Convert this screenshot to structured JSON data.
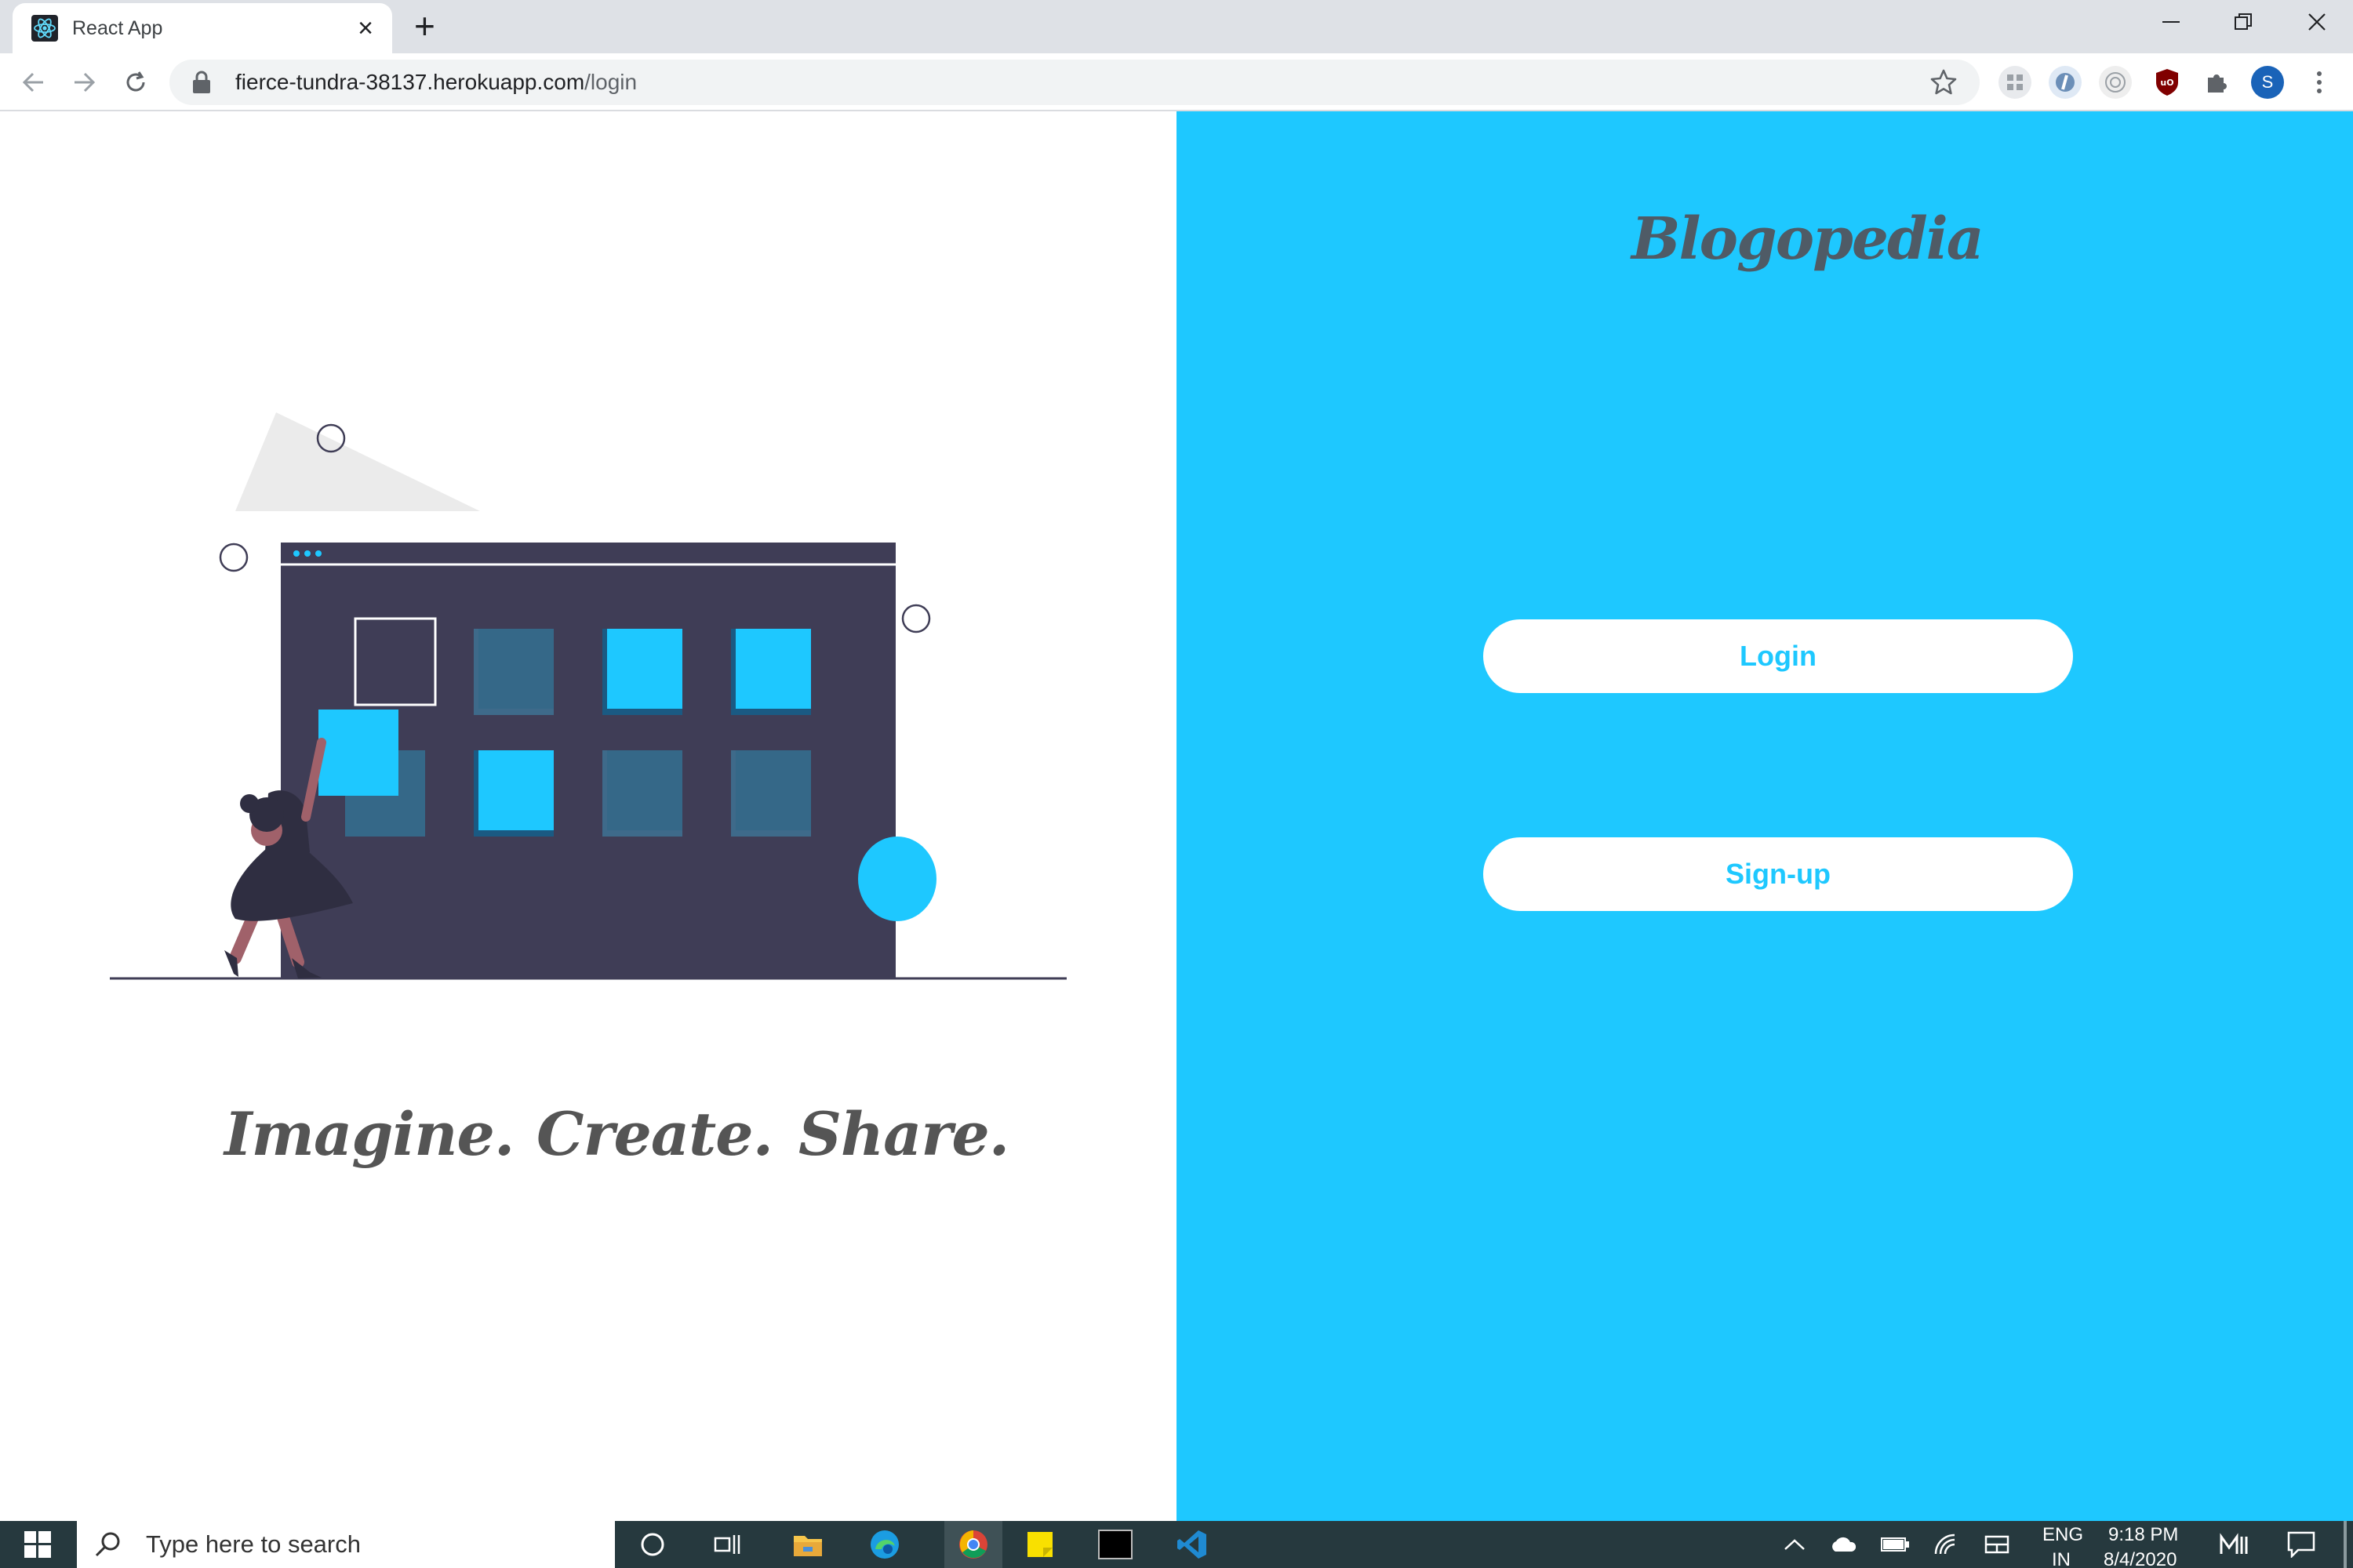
{
  "browser": {
    "tab_title": "React App",
    "url_host": "fierce-tundra-38137.herokuapp.com",
    "url_path": "/login",
    "profile_initial": "S"
  },
  "left_panel": {
    "taglines": [
      "Imagine.",
      "Create.",
      "Share."
    ]
  },
  "right_panel": {
    "brand": "Blogopedia",
    "login_label": "Login",
    "signup_label": "Sign-up"
  },
  "taskbar": {
    "search_placeholder": "Type here to search",
    "lang": "ENG",
    "lang_sub": "IN",
    "time": "9:18 PM",
    "date": "8/4/2020"
  },
  "colors": {
    "accent": "#1ec8ff",
    "dark": "#3f3d56",
    "text_gray": "#555555"
  }
}
